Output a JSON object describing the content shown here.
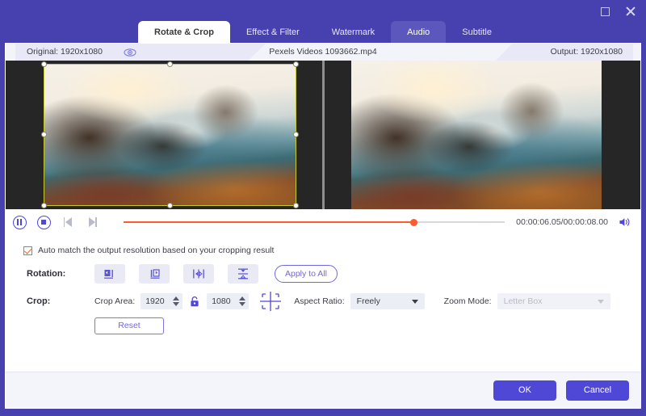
{
  "window": {
    "maximize_icon": "maximize-icon",
    "close_icon": "close-icon"
  },
  "tabs": [
    {
      "label": "Rotate & Crop",
      "state": "active"
    },
    {
      "label": "Effect & Filter",
      "state": "normal"
    },
    {
      "label": "Watermark",
      "state": "normal"
    },
    {
      "label": "Audio",
      "state": "hover"
    },
    {
      "label": "Subtitle",
      "state": "normal"
    }
  ],
  "infobar": {
    "original_label": "Original: 1920x1080",
    "preview_eye_icon": "eye-icon",
    "filename": "Pexels Videos 1093662.mp4",
    "output_label": "Output: 1920x1080"
  },
  "player": {
    "pause_icon": "pause-icon",
    "stop_icon": "stop-icon",
    "prev_frame_icon": "previous-frame-icon",
    "next_frame_icon": "next-frame-icon",
    "progress_percent": 76,
    "timecode": "00:00:06.05/00:00:08.00",
    "volume_icon": "volume-icon"
  },
  "options": {
    "auto_match_label": "Auto match the output resolution based on your cropping result",
    "auto_match_checked": true
  },
  "rotation": {
    "label": "Rotation:",
    "buttons": [
      {
        "name": "rotate-left-button",
        "icon": "rotate-left-icon"
      },
      {
        "name": "rotate-right-button",
        "icon": "rotate-right-icon"
      },
      {
        "name": "flip-horizontal-button",
        "icon": "flip-horizontal-icon"
      },
      {
        "name": "flip-vertical-button",
        "icon": "flip-vertical-icon"
      }
    ],
    "apply_to_all_label": "Apply to All"
  },
  "crop": {
    "label": "Crop:",
    "crop_area_label": "Crop Area:",
    "width_value": "1920",
    "height_value": "1080",
    "lock_icon": "lock-aspect-icon",
    "position_icon": "crop-position-icon",
    "aspect_ratio_label": "Aspect Ratio:",
    "aspect_ratio_value": "Freely",
    "zoom_mode_label": "Zoom Mode:",
    "zoom_mode_value": "Letter Box",
    "zoom_mode_disabled": true,
    "reset_label": "Reset"
  },
  "footer": {
    "ok_label": "OK",
    "cancel_label": "Cancel"
  },
  "colors": {
    "brand_purple": "#4741b0",
    "accent_indigo": "#4f47d6",
    "progress_orange": "#ff5b2e",
    "crop_outline_yellow": "#c8c832",
    "checkbox_orange": "#f26522"
  }
}
